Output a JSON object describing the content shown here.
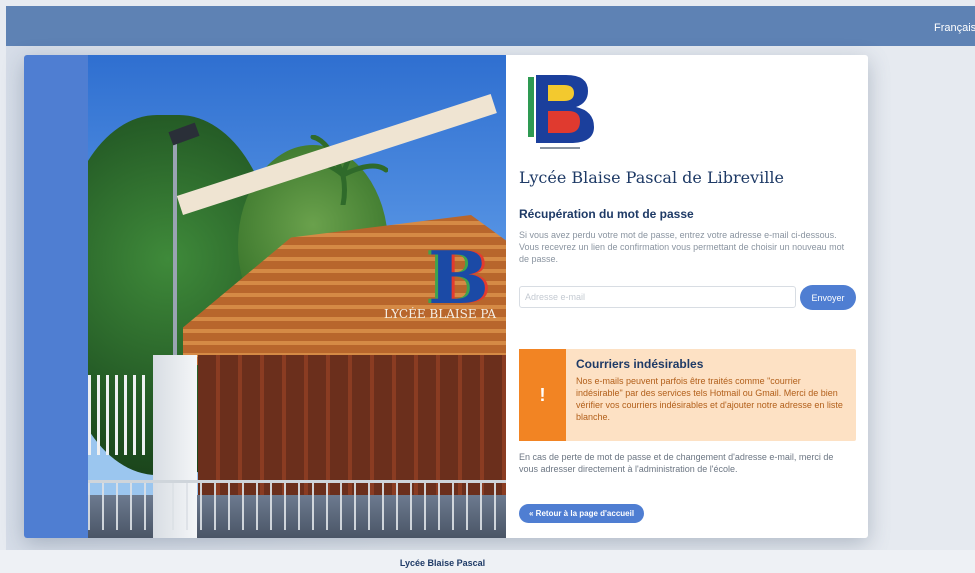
{
  "topbar": {
    "language_label": "Français",
    "flag_colors": [
      "#2a55b8",
      "#ffffff",
      "#d8332d"
    ]
  },
  "photo": {
    "sign_letter": "B",
    "sign_text": "LYCÉE BLAISE PA"
  },
  "panel": {
    "school_name": "Lycée Blaise Pascal de Libreville",
    "section_title": "Récupération du mot de passe",
    "intro_text": "Si vous avez perdu votre mot de passe, entrez votre adresse e-mail ci-dessous. Vous recevrez un lien de confirmation vous permettant de choisir un nouveau mot de passe.",
    "email_placeholder": "Adresse e-mail",
    "email_value": "",
    "send_label": "Envoyer",
    "alert": {
      "icon": "!",
      "title": "Courriers indésirables",
      "text": "Nos e-mails peuvent parfois être traités comme \"courrier indésirable\" par des services tels Hotmail ou Gmail. Merci de bien vérifier vos courriers indésirables et d'ajouter notre adresse en liste blanche."
    },
    "note_text": "En cas de perte de mot de passe et de changement d'adresse e-mail, merci de vous adresser directement à l'administration de l'école.",
    "back_label": "« Retour à la page d'accueil"
  },
  "footer": {
    "text": "Lycée Blaise Pascal"
  },
  "colors": {
    "primary": "#4f7ed2",
    "topbar": "#5e82b4",
    "alert_accent": "#f28423",
    "alert_bg": "#fde1c4",
    "title": "#1e3a66"
  }
}
